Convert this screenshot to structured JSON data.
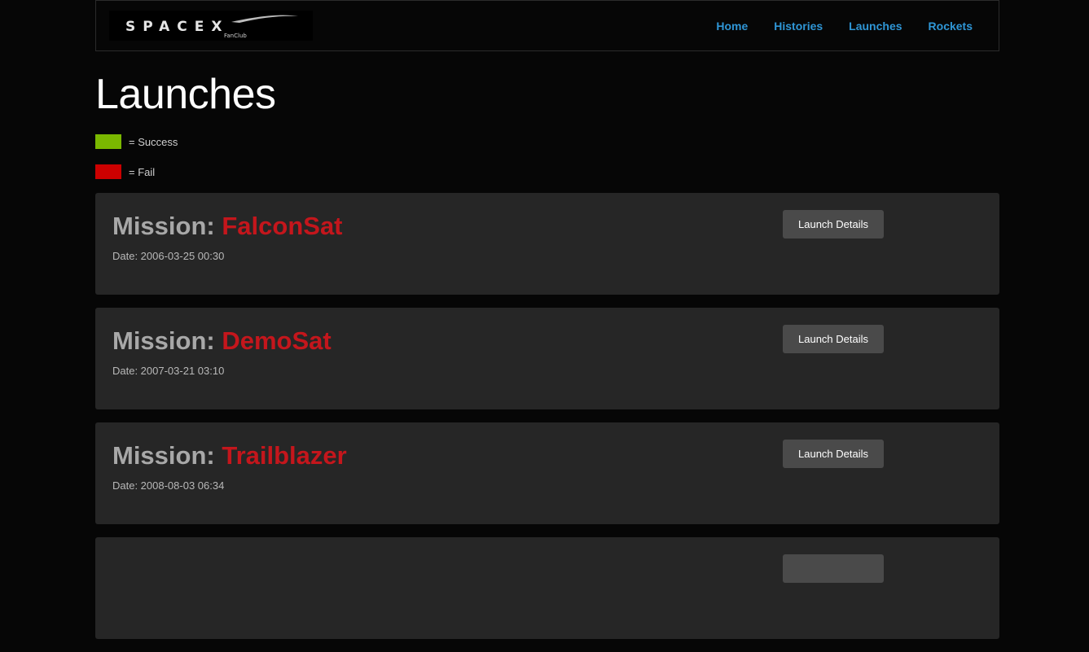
{
  "brand": {
    "logo_text": "SPACEX",
    "logo_subtext": "FanClub"
  },
  "nav": {
    "items": [
      {
        "label": "Home"
      },
      {
        "label": "Histories"
      },
      {
        "label": "Launches"
      },
      {
        "label": "Rockets"
      }
    ],
    "link_color": "#2f96d6"
  },
  "page": {
    "title": "Launches"
  },
  "legend": {
    "success": {
      "label": "= Success",
      "color": "#7ab800"
    },
    "fail": {
      "label": "= Fail",
      "color": "#cc0000"
    }
  },
  "launches": [
    {
      "prefix": "Mission:",
      "name": "FalconSat",
      "date": "Date: 2006-03-25 00:30",
      "status": "fail",
      "button": "Launch Details"
    },
    {
      "prefix": "Mission:",
      "name": "DemoSat",
      "date": "Date: 2007-03-21 03:10",
      "status": "fail",
      "button": "Launch Details"
    },
    {
      "prefix": "Mission:",
      "name": "Trailblazer",
      "date": "Date: 2008-08-03 06:34",
      "status": "fail",
      "button": "Launch Details"
    },
    {
      "prefix": "",
      "name": "",
      "date": "",
      "status": "",
      "button": ""
    }
  ]
}
